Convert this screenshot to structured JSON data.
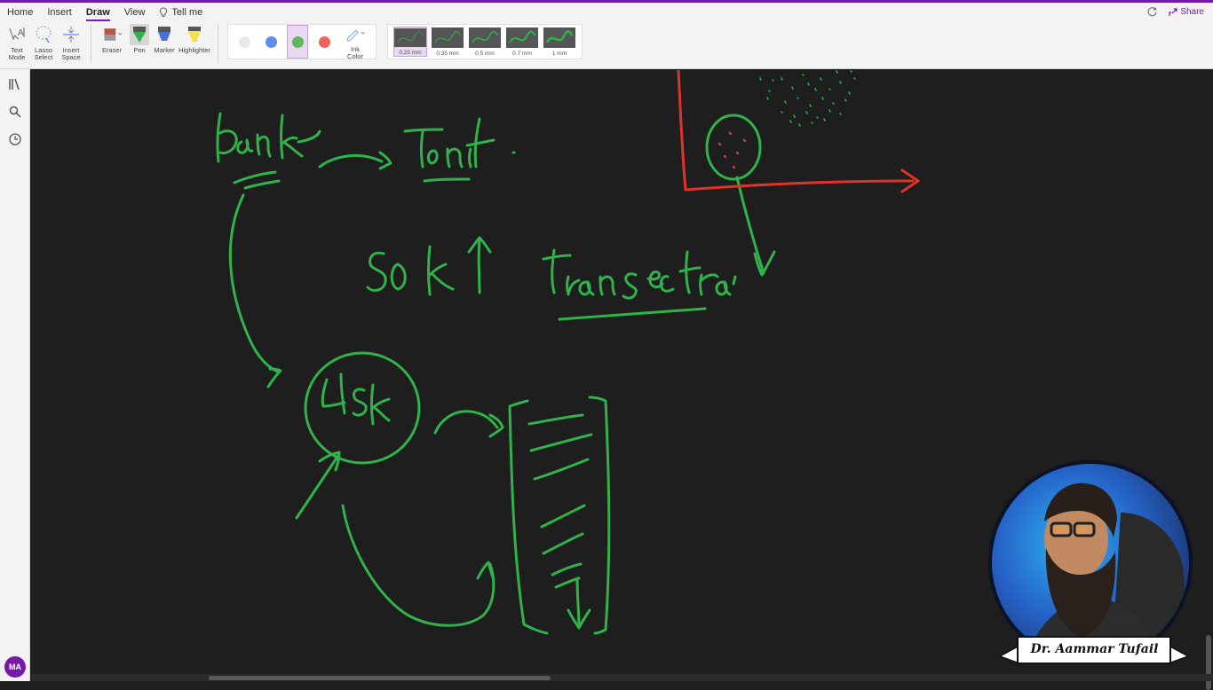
{
  "ribbon": {
    "tabs": [
      {
        "label": "Home"
      },
      {
        "label": "Insert"
      },
      {
        "label": "Draw"
      },
      {
        "label": "View"
      }
    ],
    "tell_me": "Tell me",
    "share": "Share",
    "tools": {
      "text_mode": "Text Mode",
      "lasso_select": "Lasso Select",
      "insert_space": "Insert Space",
      "eraser": "Eraser",
      "pen": "Pen",
      "marker": "Marker",
      "highlighter": "Highlighter",
      "ink_color": "Ink Color"
    },
    "colors": [
      "#e8e8e8",
      "#5b8def",
      "#5cb85c",
      "#f0625a"
    ],
    "thickness": [
      {
        "label": "0.25 mm"
      },
      {
        "label": "0.35 mm"
      },
      {
        "label": "0.5 mm"
      },
      {
        "label": "0.7 mm"
      },
      {
        "label": "1 mm"
      }
    ]
  },
  "sidebar": {
    "icons": [
      "notebooks-icon",
      "search-icon",
      "recent-icon"
    ],
    "avatar": "MA"
  },
  "canvas": {
    "ink_green": "#2fb34a",
    "ink_red": "#e2332a"
  },
  "presenter": {
    "name": "Dr. Aammar Tufail"
  }
}
